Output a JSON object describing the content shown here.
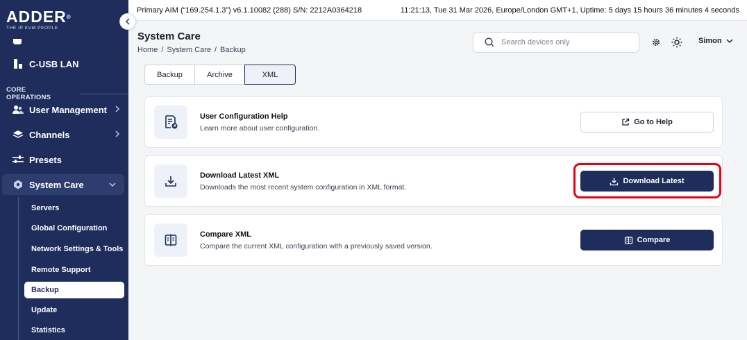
{
  "brand": {
    "name": "ADDER",
    "mark": "®",
    "tagline": "THE IP KVM PEOPLE"
  },
  "topbar": {
    "device_info": "Primary AIM (“169.254.1.3”) v6.1.10082 (288) S/N: 2212A0364218",
    "status": "11:21:13, Tue 31 Mar 2026, Europe/London GMT+1, Uptime: 5 days 15 hours 36 minutes 4 seconds"
  },
  "sidebar": {
    "usb_item": "C-USB LAN",
    "section_label": "CORE OPERATIONS",
    "items": [
      {
        "label": "User Management"
      },
      {
        "label": "Channels"
      },
      {
        "label": "Presets"
      },
      {
        "label": "System Care"
      }
    ],
    "sub_items": [
      {
        "label": "Servers"
      },
      {
        "label": "Global Configuration"
      },
      {
        "label": "Network Settings & Tools"
      },
      {
        "label": "Remote Support"
      },
      {
        "label": "Backup"
      },
      {
        "label": "Update"
      },
      {
        "label": "Statistics"
      }
    ]
  },
  "header": {
    "title": "System Care",
    "breadcrumb": [
      "Home",
      "System Care",
      "Backup"
    ],
    "search_placeholder": "Search devices only",
    "user": "Simon"
  },
  "tabs": [
    {
      "label": "Backup"
    },
    {
      "label": "Archive"
    },
    {
      "label": "XML",
      "active": true
    }
  ],
  "cards": [
    {
      "title": "User Configuration Help",
      "description": "Learn more about user configuration.",
      "button": "Go to Help"
    },
    {
      "title": "Download Latest XML",
      "description": "Downloads the most recent system configuration in XML format.",
      "button": "Download Latest"
    },
    {
      "title": "Compare XML",
      "description": "Compare the current XML configuration with a previously saved version.",
      "button": "Compare"
    }
  ],
  "colors": {
    "sidebar": "#1e2d5c",
    "accent": "#1e2d5c",
    "highlight": "#e60012"
  }
}
